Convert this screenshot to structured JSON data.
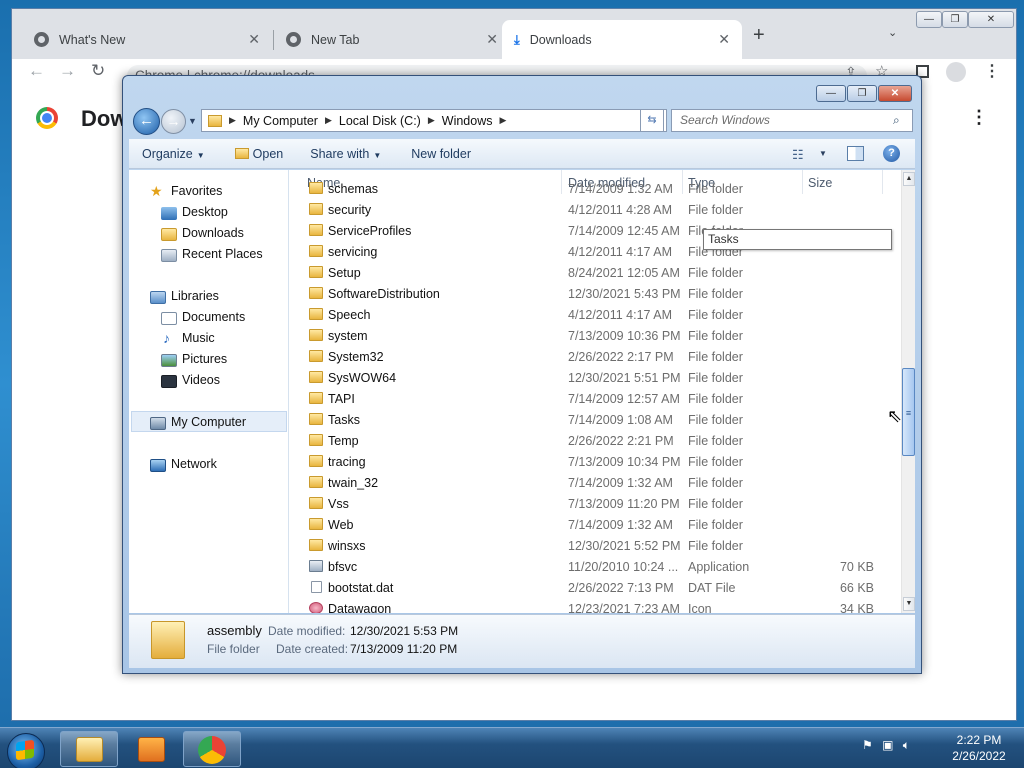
{
  "browser": {
    "tabs": [
      {
        "title": "What's New"
      },
      {
        "title": "New Tab"
      },
      {
        "title": "Downloads"
      }
    ],
    "new_tab_symbol": "+",
    "tab_close_symbol": "✕",
    "address": "Chrome  |  chrome://downloads",
    "page_title": "Downloads",
    "window_controls": [
      "—",
      "❐",
      "✕"
    ]
  },
  "explorer": {
    "caption_controls": [
      "—",
      "❐",
      "✕"
    ],
    "breadcrumb": [
      "My Computer",
      "Local Disk (C:)",
      "Windows"
    ],
    "search_placeholder": "Search Windows",
    "commands": {
      "organize": "Organize",
      "open": "Open",
      "share_with": "Share with",
      "new_folder": "New folder"
    },
    "nav": {
      "favorites": "Favorites",
      "favorites_items": [
        "Desktop",
        "Downloads",
        "Recent Places"
      ],
      "libraries": "Libraries",
      "libraries_items": [
        "Documents",
        "Music",
        "Pictures",
        "Videos"
      ],
      "computer": "My Computer",
      "network": "Network"
    },
    "columns": {
      "name": "Name",
      "date": "Date modified",
      "type": "Type",
      "size": "Size"
    },
    "rows": [
      {
        "name": "schemas",
        "date": "7/14/2009 1:32 AM",
        "type": "File folder",
        "size": "",
        "kind": "folder"
      },
      {
        "name": "security",
        "date": "4/12/2011 4:28 AM",
        "type": "File folder",
        "size": "",
        "kind": "folder"
      },
      {
        "name": "ServiceProfiles",
        "date": "7/14/2009 12:45 AM",
        "type": "File folder",
        "size": "",
        "kind": "folder"
      },
      {
        "name": "servicing",
        "date": "4/12/2011 4:17 AM",
        "type": "File folder",
        "size": "",
        "kind": "folder"
      },
      {
        "name": "Setup",
        "date": "8/24/2021 12:05 AM",
        "type": "File folder",
        "size": "",
        "kind": "folder"
      },
      {
        "name": "SoftwareDistribution",
        "date": "12/30/2021 5:43 PM",
        "type": "File folder",
        "size": "",
        "kind": "folder"
      },
      {
        "name": "Speech",
        "date": "4/12/2011 4:17 AM",
        "type": "File folder",
        "size": "",
        "kind": "folder"
      },
      {
        "name": "system",
        "date": "7/13/2009 10:36 PM",
        "type": "File folder",
        "size": "",
        "kind": "folder"
      },
      {
        "name": "System32",
        "date": "2/26/2022 2:17 PM",
        "type": "File folder",
        "size": "",
        "kind": "folder"
      },
      {
        "name": "SysWOW64",
        "date": "12/30/2021 5:51 PM",
        "type": "File folder",
        "size": "",
        "kind": "folder"
      },
      {
        "name": "TAPI",
        "date": "7/14/2009 12:57 AM",
        "type": "File folder",
        "size": "",
        "kind": "folder"
      },
      {
        "name": "Tasks",
        "date": "7/14/2009 1:08 AM",
        "type": "File folder",
        "size": "",
        "kind": "folder"
      },
      {
        "name": "Temp",
        "date": "2/26/2022 2:21 PM",
        "type": "File folder",
        "size": "",
        "kind": "folder"
      },
      {
        "name": "tracing",
        "date": "7/13/2009 10:34 PM",
        "type": "File folder",
        "size": "",
        "kind": "folder"
      },
      {
        "name": "twain_32",
        "date": "7/14/2009 1:32 AM",
        "type": "File folder",
        "size": "",
        "kind": "folder"
      },
      {
        "name": "Vss",
        "date": "7/13/2009 11:20 PM",
        "type": "File folder",
        "size": "",
        "kind": "folder"
      },
      {
        "name": "Web",
        "date": "7/14/2009 1:32 AM",
        "type": "File folder",
        "size": "",
        "kind": "folder"
      },
      {
        "name": "winsxs",
        "date": "12/30/2021 5:52 PM",
        "type": "File folder",
        "size": "",
        "kind": "folder"
      },
      {
        "name": "bfsvc",
        "date": "11/20/2010 10:24 ...",
        "type": "Application",
        "size": "70 KB",
        "kind": "app"
      },
      {
        "name": "bootstat.dat",
        "date": "2/26/2022 7:13 PM",
        "type": "DAT File",
        "size": "66 KB",
        "kind": "file"
      },
      {
        "name": "Datawagon",
        "date": "12/23/2021 7:23 AM",
        "type": "Icon",
        "size": "34 KB",
        "kind": "icon"
      }
    ],
    "tooltip": "Tasks",
    "details": {
      "name": "assembly",
      "type": "File folder",
      "modified_label": "Date modified:",
      "modified_value": "12/30/2021 5:53 PM",
      "created_label": "Date created:",
      "created_value": "7/13/2009 11:20 PM"
    }
  },
  "taskbar": {
    "time": "2:22 PM",
    "date": "2/26/2022"
  },
  "colors": {
    "chrome_tabstrip": "#dee1e6",
    "explorer_frame": "#b9d1ea",
    "selection": "#e5eef9",
    "taskbar": "#23517f"
  }
}
